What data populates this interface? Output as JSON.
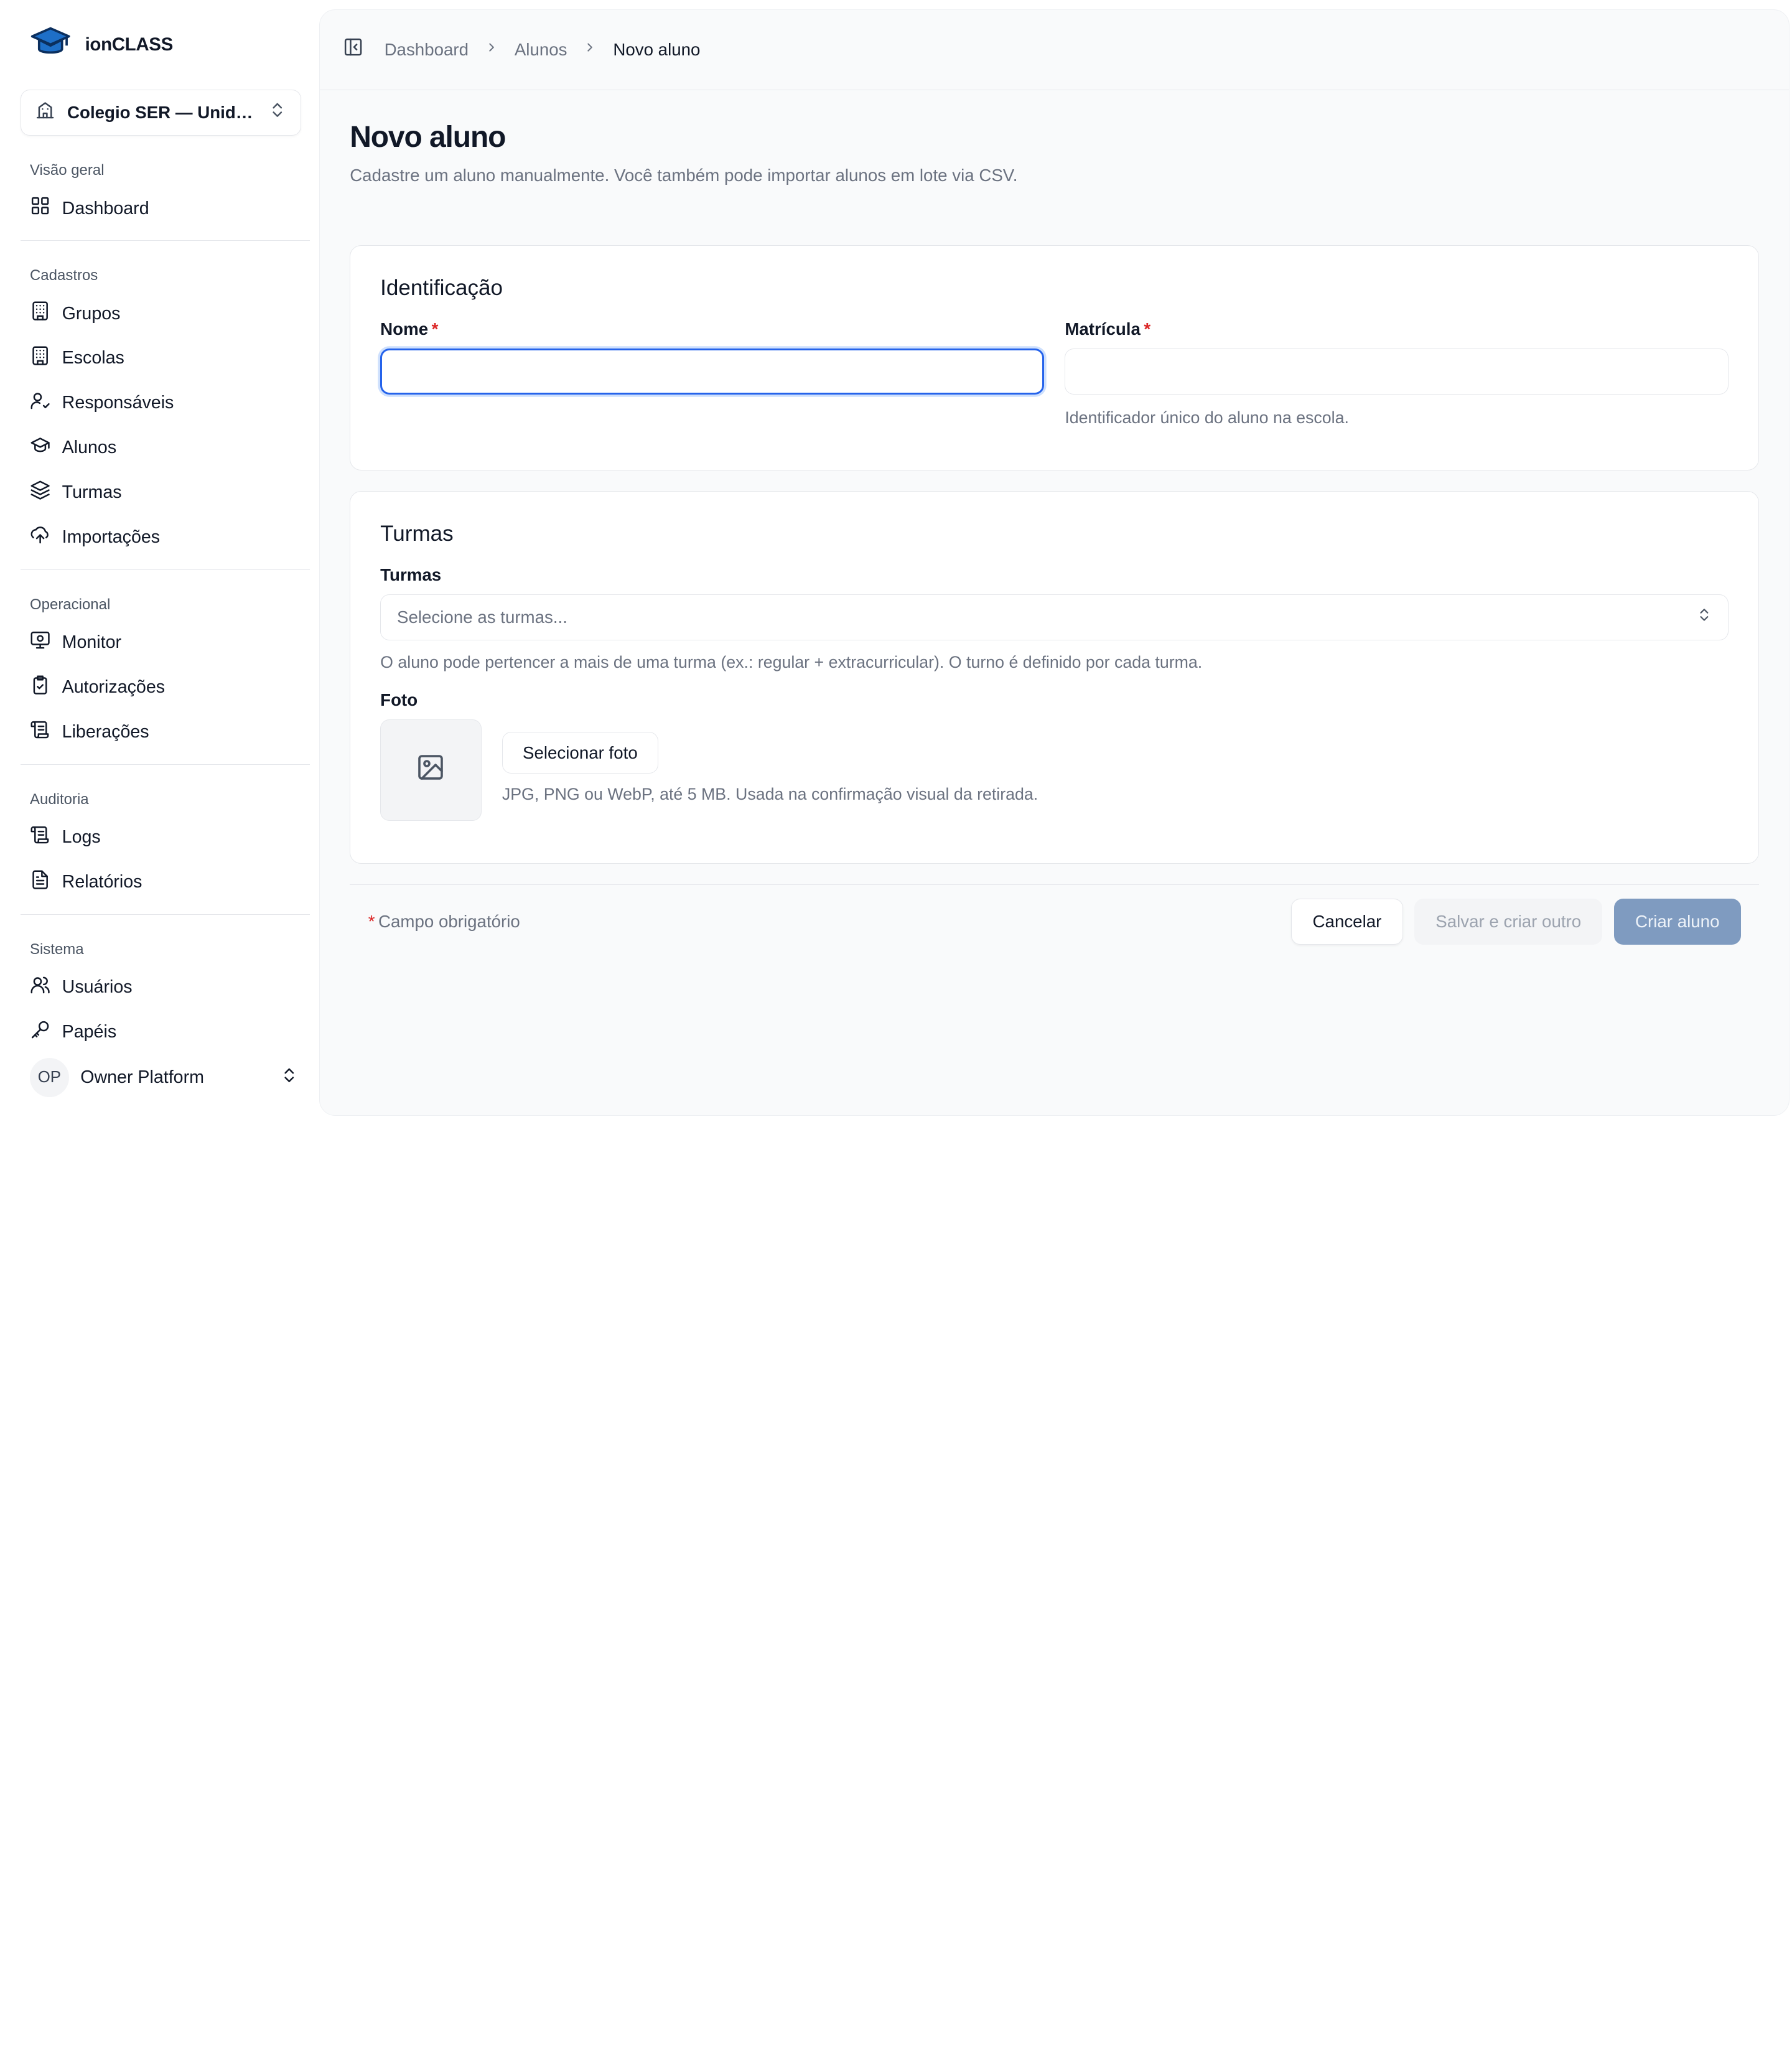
{
  "app": {
    "name": "ionCLASS",
    "brand_color": "#1e6fc8"
  },
  "switcher": {
    "label": "Colegio SER — Unida..."
  },
  "sidebar": {
    "sections": [
      {
        "title": "Visão geral",
        "items": [
          {
            "label": "Dashboard",
            "icon": "grid-icon"
          }
        ]
      },
      {
        "title": "Cadastros",
        "items": [
          {
            "label": "Grupos",
            "icon": "building-icon"
          },
          {
            "label": "Escolas",
            "icon": "building-icon"
          },
          {
            "label": "Responsáveis",
            "icon": "user-check-icon"
          },
          {
            "label": "Alunos",
            "icon": "graduation-cap-icon"
          },
          {
            "label": "Turmas",
            "icon": "layers-icon"
          },
          {
            "label": "Importações",
            "icon": "cloud-upload-icon"
          }
        ]
      },
      {
        "title": "Operacional",
        "items": [
          {
            "label": "Monitor",
            "icon": "monitor-icon"
          },
          {
            "label": "Autorizações",
            "icon": "clipboard-check-icon"
          },
          {
            "label": "Liberações",
            "icon": "scroll-icon"
          }
        ]
      },
      {
        "title": "Auditoria",
        "items": [
          {
            "label": "Logs",
            "icon": "scroll-icon"
          },
          {
            "label": "Relatórios",
            "icon": "file-text-icon"
          }
        ]
      },
      {
        "title": "Sistema",
        "items": [
          {
            "label": "Usuários",
            "icon": "users-icon"
          },
          {
            "label": "Papéis",
            "icon": "key-icon"
          }
        ]
      }
    ]
  },
  "user": {
    "initials": "OP",
    "name": "Owner Platform"
  },
  "breadcrumb": {
    "items": [
      "Dashboard",
      "Alunos"
    ],
    "current": "Novo aluno"
  },
  "page": {
    "title": "Novo aluno",
    "subtitle": "Cadastre um aluno manualmente. Você também pode importar alunos em lote via CSV."
  },
  "identificacao": {
    "title": "Identificação",
    "nome_label": "Nome",
    "nome_value": "",
    "matricula_label": "Matrícula",
    "matricula_value": "",
    "matricula_hint": "Identificador único do aluno na escola."
  },
  "turmas": {
    "title": "Turmas",
    "select_label": "Turmas",
    "select_placeholder": "Selecione as turmas...",
    "hint": "O aluno pode pertencer a mais de uma turma (ex.: regular + extracurricular). O turno é definido por cada turma."
  },
  "foto": {
    "label": "Foto",
    "button": "Selecionar foto",
    "hint": "JPG, PNG ou WebP, até 5 MB. Usada na confirmação visual da retirada."
  },
  "footer": {
    "required_mark": "*",
    "required_note": "Campo obrigatório",
    "cancel": "Cancelar",
    "save_and_new": "Salvar e criar outro",
    "create": "Criar aluno"
  },
  "required_mark": "*"
}
